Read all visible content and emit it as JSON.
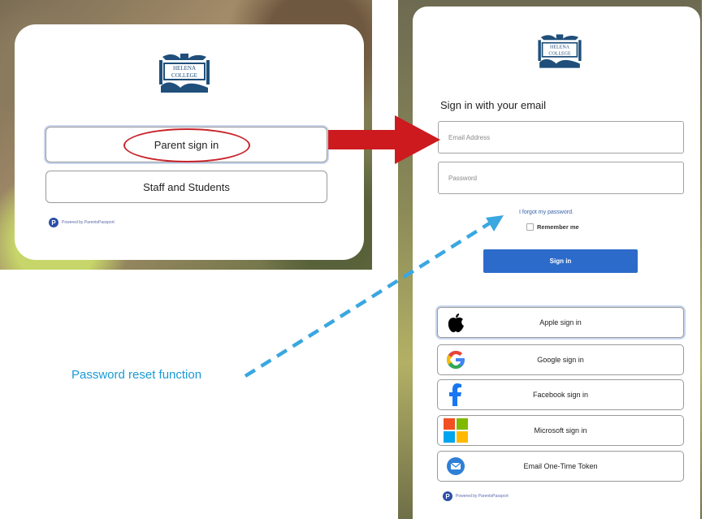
{
  "left_screen": {
    "logo": {
      "line1": "HELENA",
      "line2": "COLLEGE"
    },
    "buttons": {
      "parent": "Parent sign in",
      "staff": "Staff and Students"
    },
    "powered_by": "Powered by ParentsPassport"
  },
  "right_screen": {
    "logo": {
      "line1": "HELENA",
      "line2": "COLLEGE"
    },
    "heading": "Sign in with your email",
    "email_placeholder": "Email Address",
    "password_placeholder": "Password",
    "forgot_link": "I forgot my password.",
    "remember_me": "Remember me",
    "sign_in": "Sign in",
    "providers": [
      {
        "label": "Apple sign in",
        "icon": "apple-icon"
      },
      {
        "label": "Google sign in",
        "icon": "google-icon"
      },
      {
        "label": "Facebook sign in",
        "icon": "facebook-icon"
      },
      {
        "label": "Microsoft sign in",
        "icon": "microsoft-icon"
      },
      {
        "label": "Email One-Time Token",
        "icon": "email-icon"
      }
    ],
    "powered_by": "Powered by ParentsPassport"
  },
  "annotations": {
    "callout": "Password reset function",
    "arrow_color": "#cc1a1f",
    "dashed_color": "#3aa7e0"
  }
}
